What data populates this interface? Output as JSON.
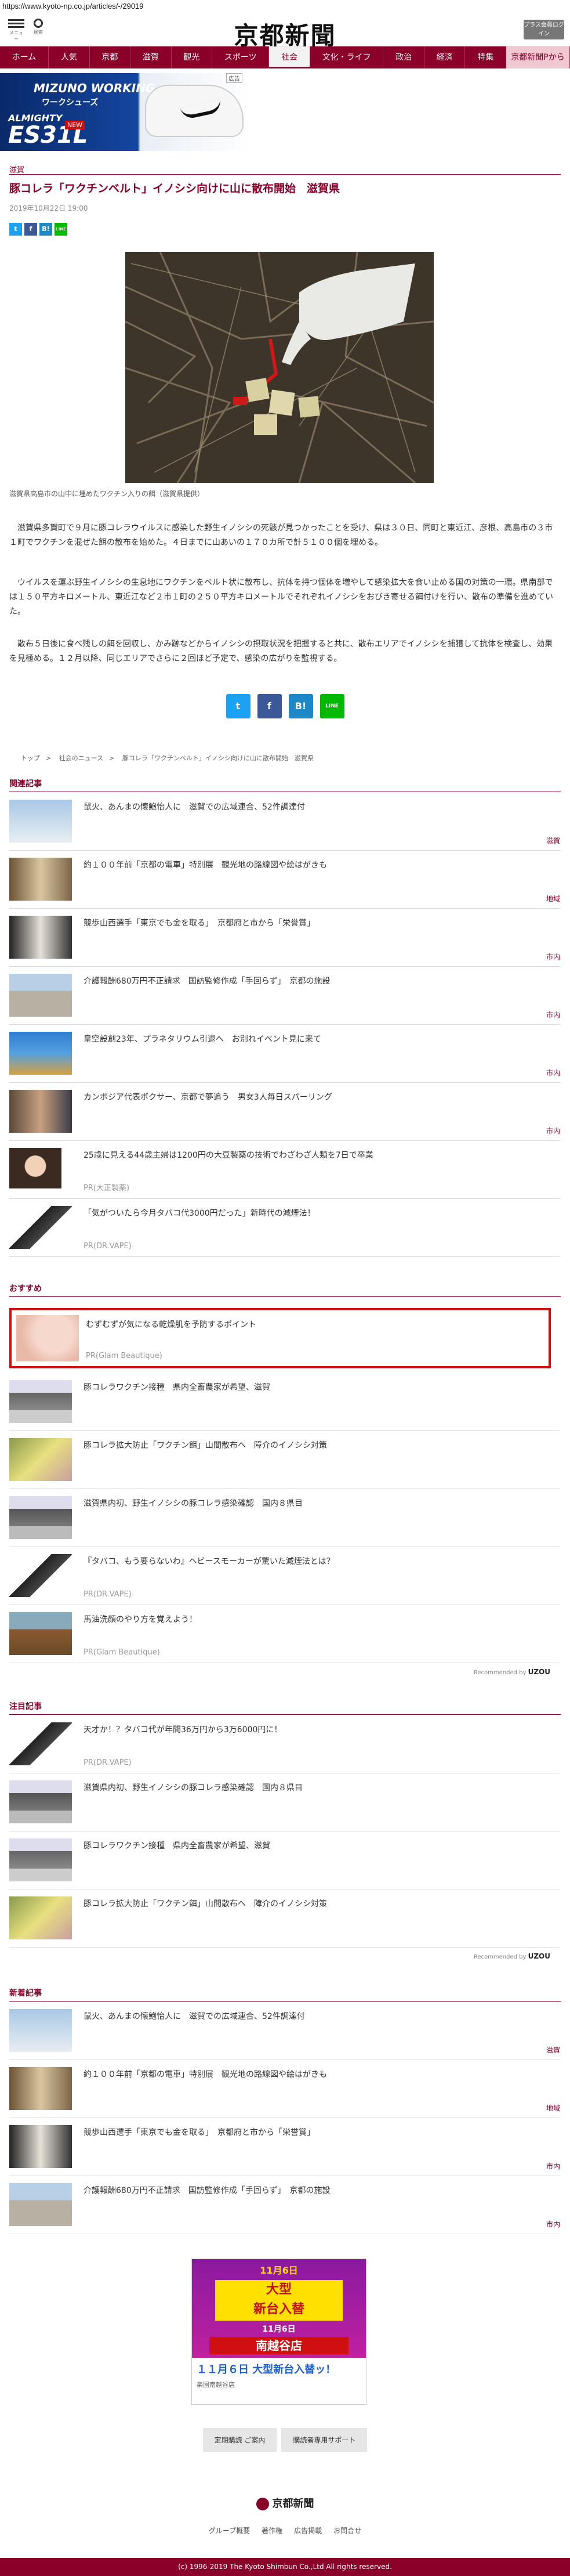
{
  "url": "https://www.kyoto-np.co.jp/articles/-/29019",
  "header": {
    "menu_label": "メニュー",
    "search_label": "検索",
    "logo": "京都新聞",
    "premium": "プラス会員ログイン"
  },
  "nav": [
    "ホーム",
    "人気",
    "京都",
    "滋賀",
    "観光",
    "スポーツ",
    "社会",
    "文化・ライフ",
    "政治",
    "経済",
    "特集",
    "京都新聞Pから"
  ],
  "ad1": {
    "label": "広告",
    "brand": "MIZUNO WORKING",
    "sub": "ワークシューズ",
    "line1": "ALMIGHTY",
    "model": "ES31L",
    "badge": "NEW"
  },
  "article": {
    "category": "滋賀",
    "title": "豚コレラ「ワクチンベルト」イノシシ向けに山に散布開始　滋賀県",
    "date": "2019年10月22日 19:00",
    "caption": "滋賀県高島市の山中に埋めたワクチン入りの餌（滋賀県提供）",
    "p1": "滋賀県多賀町で９月に豚コレラウイルスに感染した野生イノシシの死骸が見つかったことを受け、県は３０日、同町と東近江、彦根、高島市の３市１町でワクチンを混ぜた餌の散布を始めた。４日までに山あいの１７０カ所で計５１００個を埋める。",
    "p2": "ウイルスを運ぶ野生イノシシの生息地にワクチンをベルト状に散布し、抗体を持つ個体を増やして感染拡大を食い止める国の対策の一環。県南部では１５０平方キロメートル、東近江など２市１町の２５０平方キロメートルでそれぞれイノシシをおびき寄せる餌付けを行い、散布の準備を進めていた。",
    "p3": "散布５日後に食べ残しの餌を回収し、かみ跡などからイノシシの摂取状況を把握すると共に、散布エリアでイノシシを捕獲して抗体を検査し、効果を見極める。１２月以降、同じエリアでさらに２回ほど予定で、感染の広がりを監視する。"
  },
  "share": {
    "tw": "t",
    "fb": "f",
    "hb": "B!",
    "line": "LINE"
  },
  "crumbs": [
    "トップ",
    "社会のニュース",
    "豚コレラ「ワクチンベルト」イノシシ向けに山に散布開始　滋賀県"
  ],
  "related": {
    "heading": "関連記事",
    "items": [
      {
        "t": "鼠火、あんまの懐鮑怡人に　滋賀での広域連合、52件調達付",
        "c": "滋賀"
      },
      {
        "t": "約１００年前「京都の電車」特別展　観光地の路線図や絵はがきも",
        "c": "地域"
      },
      {
        "t": "競歩山西選手「東京でも金を取る」　京都府と市から「栄誉賞」",
        "c": "市内"
      },
      {
        "t": "介護報酬680万円不正請求　国訪監修作成「手回らず」　京都の施設",
        "c": "市内"
      },
      {
        "t": "皇空設創23年、プラネタリウム引退へ　お別れイベント見に来て",
        "c": "市内"
      },
      {
        "t": "カンボジア代表ボクサー、京都で夢追う　男女3人毎日スパーリング",
        "c": "市内"
      },
      {
        "t": "25歳に見える44歳主婦は1200円の大豆製薬の技術でわざわざ人類を7日で卒業",
        "c": "PR(大正製薬)"
      },
      {
        "t": "「気がついたら今月タバコ代3000円だった」新時代の減煙法！",
        "c": "PR(DR.VAPE)"
      }
    ]
  },
  "recommend": {
    "heading": "おすすめ",
    "items": [
      {
        "t": "むずむずが気になる乾燥肌を予防するポイント",
        "c": "PR(Glam Beautique)"
      },
      {
        "t": "豚コレラワクチン接種　県内全畜農家が希望、滋賀",
        "c": ""
      },
      {
        "t": "豚コレラ拡大防止「ワクチン餌」山間散布へ　障介のイノシシ対策",
        "c": ""
      },
      {
        "t": "滋賀県内初、野生イノシシの豚コレラ感染確認　国内８県目",
        "c": ""
      },
      {
        "t": "『タバコ、もう要らないわ』ヘビースモーカーが驚いた減煙法とは？",
        "c": "PR(DR.VAPE)"
      },
      {
        "t": "馬油洗顔のやり方を覚えよう！",
        "c": "PR(Glam Beautique)"
      }
    ],
    "by": "Recommended by",
    "brand": "UZOU"
  },
  "notice": {
    "heading": "注目記事",
    "items": [
      {
        "t": "天才か！？タバコ代が年間36万円から3万6000円に！",
        "c": "PR(DR.VAPE)"
      },
      {
        "t": "滋賀県内初、野生イノシシの豚コレラ感染確認　国内８県目",
        "c": ""
      },
      {
        "t": "豚コレラワクチン接種　県内全畜農家が希望、滋賀",
        "c": ""
      },
      {
        "t": "豚コレラ拡大防止「ワクチン餌」山間散布へ　障介のイノシシ対策",
        "c": ""
      }
    ],
    "by": "Recommended by",
    "brand": "UZOU"
  },
  "latest": {
    "heading": "新着記事",
    "items": [
      {
        "t": "鼠火、あんまの懐鮑怡人に　滋賀での広域連合、52件調達付",
        "c": "滋賀"
      },
      {
        "t": "約１００年前「京都の電車」特別展　観光地の路線図や絵はがきも",
        "c": "地域"
      },
      {
        "t": "競歩山西選手「東京でも金を取る」　京都府と市から「栄誉賞」",
        "c": "市内"
      },
      {
        "t": "介護報酬680万円不正請求　国訪監修作成「手回らず」　京都の施設",
        "c": "市内"
      }
    ]
  },
  "ad2": {
    "top": "11月6日",
    "big": "大型\n新台入替",
    "date": "11月6日",
    "store": "南越谷店",
    "caption": "１１月６日 大型新台入替ッ！",
    "small": "楽園南越谷店"
  },
  "footer": {
    "btn1": "定期購読 ご案内",
    "btn2": "購読者専用サポート",
    "logo": "京都新聞",
    "links": [
      "グループ概要",
      "著作権",
      "広告掲載",
      "お問合せ"
    ],
    "copy": "(c) 1996-2019 The Kyoto Shimbun Co.,Ltd All rights reserved."
  }
}
